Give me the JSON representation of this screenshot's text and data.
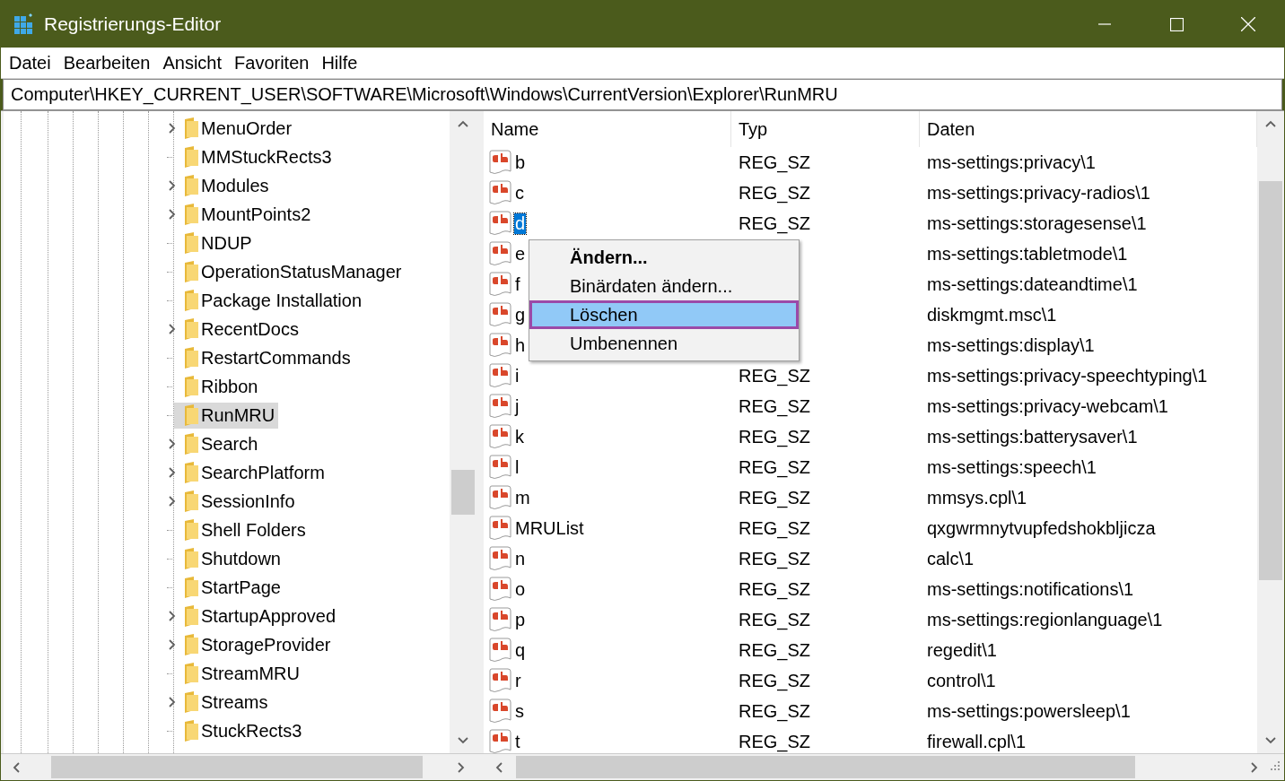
{
  "window": {
    "title": "Registrierungs-Editor"
  },
  "menu": [
    "Datei",
    "Bearbeiten",
    "Ansicht",
    "Favoriten",
    "Hilfe"
  ],
  "address": "Computer\\HKEY_CURRENT_USER\\SOFTWARE\\Microsoft\\Windows\\CurrentVersion\\Explorer\\RunMRU",
  "tree": [
    {
      "label": "MenuOrder",
      "expandable": true,
      "selected": false
    },
    {
      "label": "MMStuckRects3",
      "expandable": false,
      "selected": false
    },
    {
      "label": "Modules",
      "expandable": true,
      "selected": false
    },
    {
      "label": "MountPoints2",
      "expandable": true,
      "selected": false
    },
    {
      "label": "NDUP",
      "expandable": false,
      "selected": false
    },
    {
      "label": "OperationStatusManager",
      "expandable": false,
      "selected": false
    },
    {
      "label": "Package Installation",
      "expandable": false,
      "selected": false
    },
    {
      "label": "RecentDocs",
      "expandable": true,
      "selected": false
    },
    {
      "label": "RestartCommands",
      "expandable": false,
      "selected": false
    },
    {
      "label": "Ribbon",
      "expandable": false,
      "selected": false
    },
    {
      "label": "RunMRU",
      "expandable": false,
      "selected": true
    },
    {
      "label": "Search",
      "expandable": true,
      "selected": false
    },
    {
      "label": "SearchPlatform",
      "expandable": true,
      "selected": false
    },
    {
      "label": "SessionInfo",
      "expandable": true,
      "selected": false
    },
    {
      "label": "Shell Folders",
      "expandable": false,
      "selected": false
    },
    {
      "label": "Shutdown",
      "expandable": false,
      "selected": false
    },
    {
      "label": "StartPage",
      "expandable": false,
      "selected": false
    },
    {
      "label": "StartupApproved",
      "expandable": true,
      "selected": false
    },
    {
      "label": "StorageProvider",
      "expandable": true,
      "selected": false
    },
    {
      "label": "StreamMRU",
      "expandable": false,
      "selected": false
    },
    {
      "label": "Streams",
      "expandable": true,
      "selected": false
    },
    {
      "label": "StuckRects3",
      "expandable": false,
      "selected": false
    }
  ],
  "table": {
    "columns": [
      "Name",
      "Typ",
      "Daten"
    ],
    "rows": [
      {
        "name": "b",
        "type": "REG_SZ",
        "data": "ms-settings:privacy\\1",
        "selected": false
      },
      {
        "name": "c",
        "type": "REG_SZ",
        "data": "ms-settings:privacy-radios\\1",
        "selected": false
      },
      {
        "name": "d",
        "type": "REG_SZ",
        "data": "ms-settings:storagesense\\1",
        "selected": true
      },
      {
        "name": "e",
        "data": "ms-settings:tabletmode\\1",
        "selected": false
      },
      {
        "name": "f",
        "data": "ms-settings:dateandtime\\1",
        "selected": false
      },
      {
        "name": "g",
        "data": "diskmgmt.msc\\1",
        "selected": false
      },
      {
        "name": "h",
        "data": "ms-settings:display\\1",
        "selected": false
      },
      {
        "name": "i",
        "type": "REG_SZ",
        "data": "ms-settings:privacy-speechtyping\\1",
        "selected": false
      },
      {
        "name": "j",
        "type": "REG_SZ",
        "data": "ms-settings:privacy-webcam\\1",
        "selected": false
      },
      {
        "name": "k",
        "type": "REG_SZ",
        "data": "ms-settings:batterysaver\\1",
        "selected": false
      },
      {
        "name": "l",
        "type": "REG_SZ",
        "data": "ms-settings:speech\\1",
        "selected": false
      },
      {
        "name": "m",
        "type": "REG_SZ",
        "data": "mmsys.cpl\\1",
        "selected": false
      },
      {
        "name": "MRUList",
        "type": "REG_SZ",
        "data": "qxgwrmnytvupfedshokbljicza",
        "selected": false
      },
      {
        "name": "n",
        "type": "REG_SZ",
        "data": "calc\\1",
        "selected": false
      },
      {
        "name": "o",
        "type": "REG_SZ",
        "data": "ms-settings:notifications\\1",
        "selected": false
      },
      {
        "name": "p",
        "type": "REG_SZ",
        "data": "ms-settings:regionlanguage\\1",
        "selected": false
      },
      {
        "name": "q",
        "type": "REG_SZ",
        "data": "regedit\\1",
        "selected": false
      },
      {
        "name": "r",
        "type": "REG_SZ",
        "data": "control\\1",
        "selected": false
      },
      {
        "name": "s",
        "type": "REG_SZ",
        "data": "ms-settings:powersleep\\1",
        "selected": false
      },
      {
        "name": "t",
        "type": "REG_SZ",
        "data": "firewall.cpl\\1",
        "selected": false
      }
    ]
  },
  "context_menu": [
    {
      "label": "Ändern...",
      "default": true,
      "selected": false
    },
    {
      "label": "Binärdaten ändern...",
      "default": false,
      "selected": false
    },
    {
      "label": "Löschen",
      "default": false,
      "selected": true
    },
    {
      "label": "Umbenennen",
      "default": false,
      "selected": false
    }
  ]
}
